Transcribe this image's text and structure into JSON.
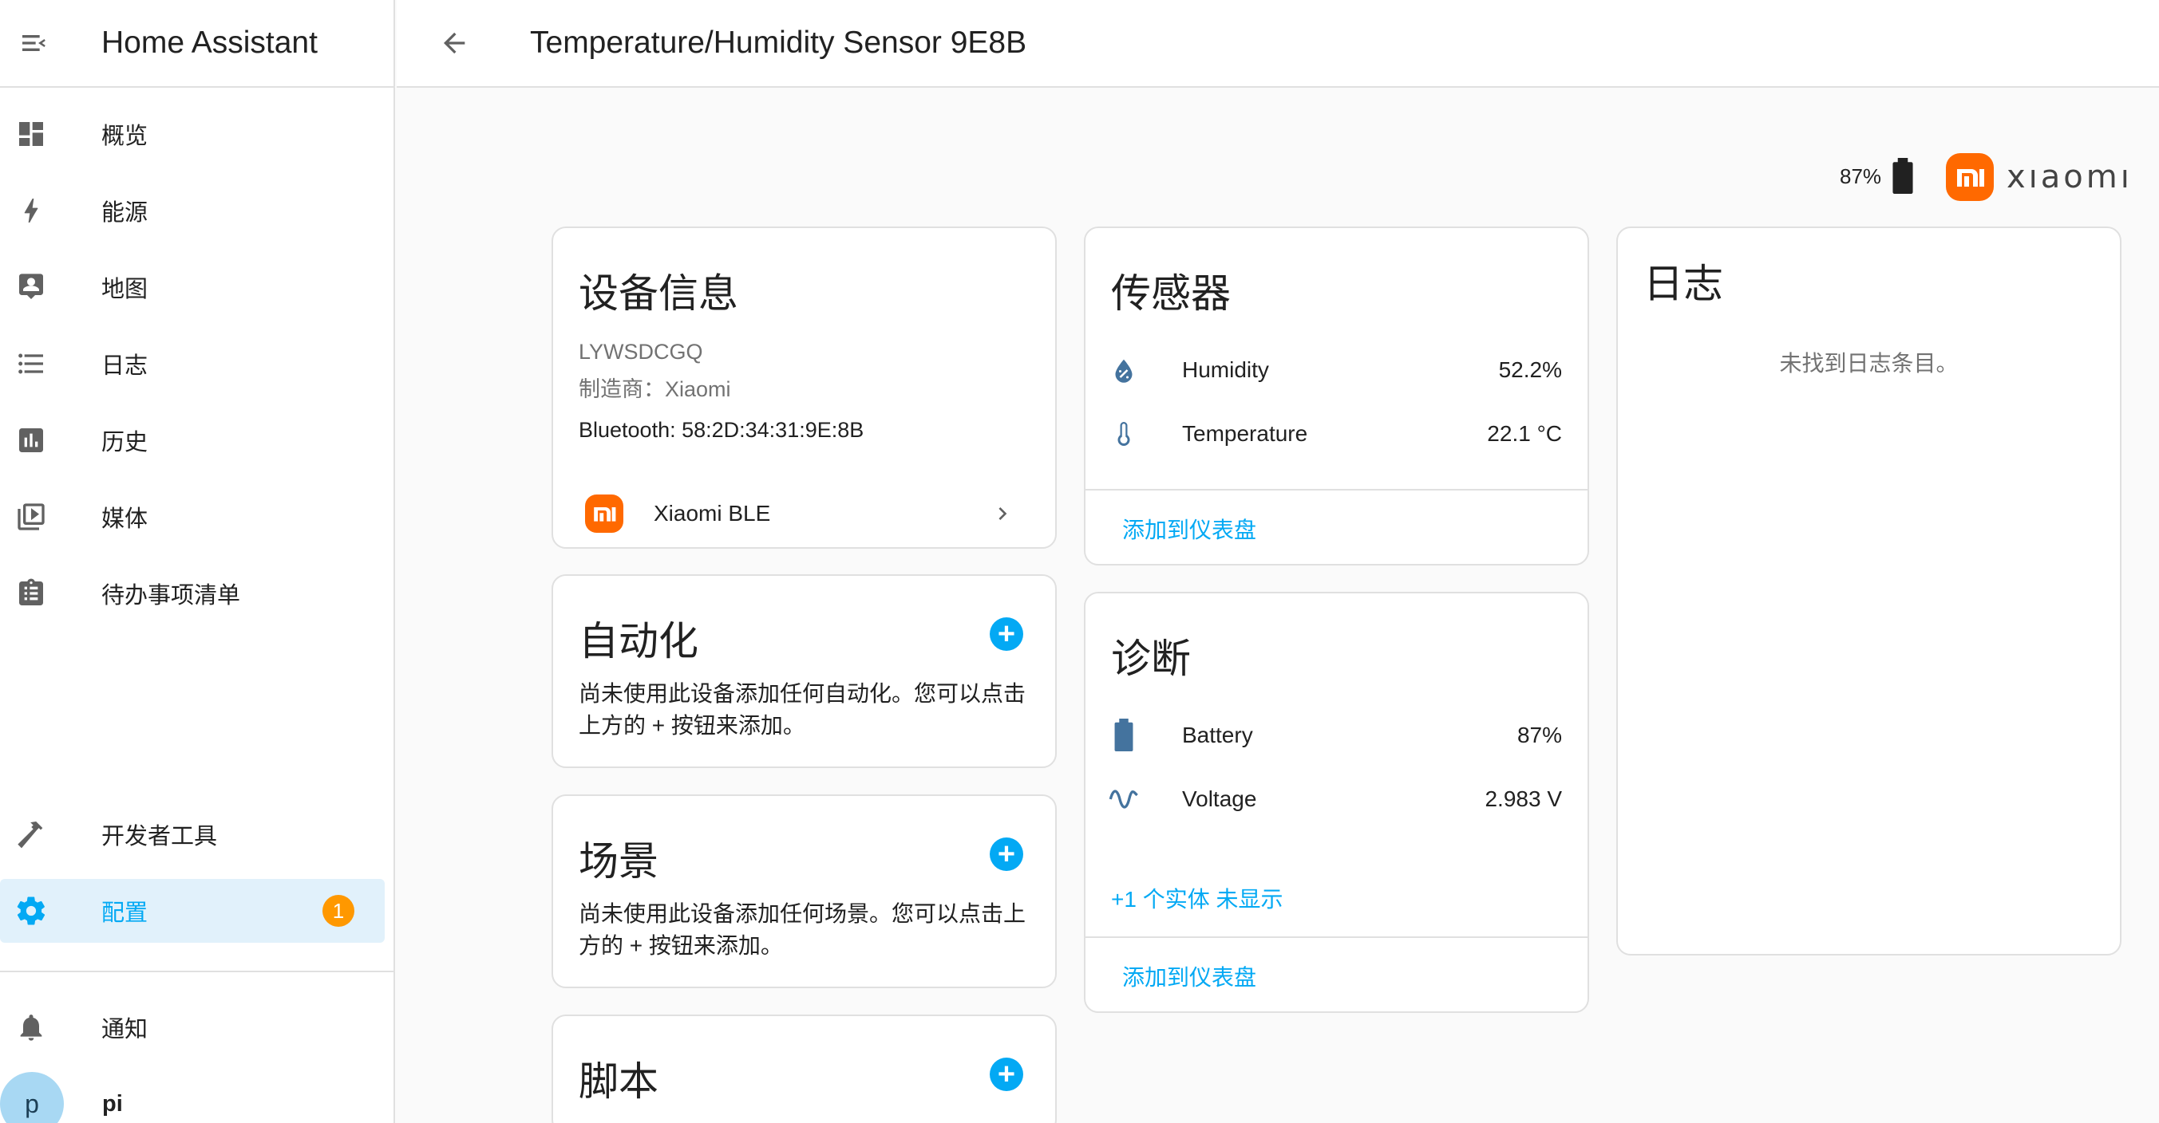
{
  "app": {
    "title": "Home Assistant"
  },
  "sidebar": {
    "items": [
      {
        "label": "概览",
        "icon": "dashboard-icon"
      },
      {
        "label": "能源",
        "icon": "lightning-icon"
      },
      {
        "label": "地图",
        "icon": "map-person-icon"
      },
      {
        "label": "日志",
        "icon": "list-icon"
      },
      {
        "label": "历史",
        "icon": "chart-icon"
      },
      {
        "label": "媒体",
        "icon": "media-play-icon"
      },
      {
        "label": "待办事项清单",
        "icon": "clipboard-list-icon"
      }
    ],
    "dev_tools": "开发者工具",
    "config": "配置",
    "config_badge": "1",
    "notifications": "通知",
    "user_initial": "p",
    "user_name": "pi"
  },
  "topbar": {
    "title": "Temperature/Humidity Sensor 9E8B"
  },
  "header": {
    "battery_level": "87%",
    "brand_name": "xıaomı"
  },
  "device_info": {
    "title": "设备信息",
    "model": "LYWSDCGQ",
    "manufacturer": "制造商：Xiaomi",
    "connection": "Bluetooth: 58:2D:34:31:9E:8B",
    "integration": "Xiaomi BLE"
  },
  "automation": {
    "title": "自动化",
    "description": "尚未使用此设备添加任何自动化。您可以点击上方的 + 按钮来添加。"
  },
  "scene": {
    "title": "场景",
    "description": "尚未使用此设备添加任何场景。您可以点击上方的 + 按钮来添加。"
  },
  "script": {
    "title": "脚本"
  },
  "sensors": {
    "title": "传感器",
    "rows": [
      {
        "label": "Humidity",
        "value": "52.2%"
      },
      {
        "label": "Temperature",
        "value": "22.1 °C"
      }
    ],
    "action": "添加到仪表盘"
  },
  "diagnostics": {
    "title": "诊断",
    "rows": [
      {
        "label": "Battery",
        "value": "87%"
      },
      {
        "label": "Voltage",
        "value": "2.983 V"
      }
    ],
    "hidden_entities": "+1 个实体 未显示",
    "action": "添加到仪表盘"
  },
  "logbook": {
    "title": "日志",
    "empty": "未找到日志条目。"
  },
  "colors": {
    "accent": "#03a9f4",
    "badge": "#ff9800",
    "brand": "#ff6900",
    "icon": "#44739e"
  }
}
